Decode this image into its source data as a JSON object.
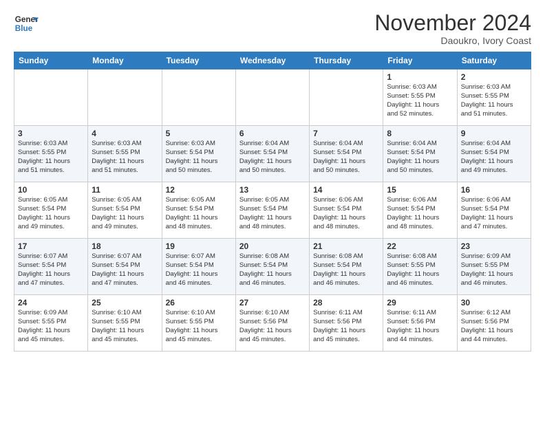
{
  "header": {
    "logo_line1": "General",
    "logo_line2": "Blue",
    "month": "November 2024",
    "location": "Daoukro, Ivory Coast"
  },
  "weekdays": [
    "Sunday",
    "Monday",
    "Tuesday",
    "Wednesday",
    "Thursday",
    "Friday",
    "Saturday"
  ],
  "weeks": [
    [
      {
        "day": "",
        "info": ""
      },
      {
        "day": "",
        "info": ""
      },
      {
        "day": "",
        "info": ""
      },
      {
        "day": "",
        "info": ""
      },
      {
        "day": "",
        "info": ""
      },
      {
        "day": "1",
        "info": "Sunrise: 6:03 AM\nSunset: 5:55 PM\nDaylight: 11 hours\nand 52 minutes."
      },
      {
        "day": "2",
        "info": "Sunrise: 6:03 AM\nSunset: 5:55 PM\nDaylight: 11 hours\nand 51 minutes."
      }
    ],
    [
      {
        "day": "3",
        "info": "Sunrise: 6:03 AM\nSunset: 5:55 PM\nDaylight: 11 hours\nand 51 minutes."
      },
      {
        "day": "4",
        "info": "Sunrise: 6:03 AM\nSunset: 5:55 PM\nDaylight: 11 hours\nand 51 minutes."
      },
      {
        "day": "5",
        "info": "Sunrise: 6:03 AM\nSunset: 5:54 PM\nDaylight: 11 hours\nand 50 minutes."
      },
      {
        "day": "6",
        "info": "Sunrise: 6:04 AM\nSunset: 5:54 PM\nDaylight: 11 hours\nand 50 minutes."
      },
      {
        "day": "7",
        "info": "Sunrise: 6:04 AM\nSunset: 5:54 PM\nDaylight: 11 hours\nand 50 minutes."
      },
      {
        "day": "8",
        "info": "Sunrise: 6:04 AM\nSunset: 5:54 PM\nDaylight: 11 hours\nand 50 minutes."
      },
      {
        "day": "9",
        "info": "Sunrise: 6:04 AM\nSunset: 5:54 PM\nDaylight: 11 hours\nand 49 minutes."
      }
    ],
    [
      {
        "day": "10",
        "info": "Sunrise: 6:05 AM\nSunset: 5:54 PM\nDaylight: 11 hours\nand 49 minutes."
      },
      {
        "day": "11",
        "info": "Sunrise: 6:05 AM\nSunset: 5:54 PM\nDaylight: 11 hours\nand 49 minutes."
      },
      {
        "day": "12",
        "info": "Sunrise: 6:05 AM\nSunset: 5:54 PM\nDaylight: 11 hours\nand 48 minutes."
      },
      {
        "day": "13",
        "info": "Sunrise: 6:05 AM\nSunset: 5:54 PM\nDaylight: 11 hours\nand 48 minutes."
      },
      {
        "day": "14",
        "info": "Sunrise: 6:06 AM\nSunset: 5:54 PM\nDaylight: 11 hours\nand 48 minutes."
      },
      {
        "day": "15",
        "info": "Sunrise: 6:06 AM\nSunset: 5:54 PM\nDaylight: 11 hours\nand 48 minutes."
      },
      {
        "day": "16",
        "info": "Sunrise: 6:06 AM\nSunset: 5:54 PM\nDaylight: 11 hours\nand 47 minutes."
      }
    ],
    [
      {
        "day": "17",
        "info": "Sunrise: 6:07 AM\nSunset: 5:54 PM\nDaylight: 11 hours\nand 47 minutes."
      },
      {
        "day": "18",
        "info": "Sunrise: 6:07 AM\nSunset: 5:54 PM\nDaylight: 11 hours\nand 47 minutes."
      },
      {
        "day": "19",
        "info": "Sunrise: 6:07 AM\nSunset: 5:54 PM\nDaylight: 11 hours\nand 46 minutes."
      },
      {
        "day": "20",
        "info": "Sunrise: 6:08 AM\nSunset: 5:54 PM\nDaylight: 11 hours\nand 46 minutes."
      },
      {
        "day": "21",
        "info": "Sunrise: 6:08 AM\nSunset: 5:54 PM\nDaylight: 11 hours\nand 46 minutes."
      },
      {
        "day": "22",
        "info": "Sunrise: 6:08 AM\nSunset: 5:55 PM\nDaylight: 11 hours\nand 46 minutes."
      },
      {
        "day": "23",
        "info": "Sunrise: 6:09 AM\nSunset: 5:55 PM\nDaylight: 11 hours\nand 46 minutes."
      }
    ],
    [
      {
        "day": "24",
        "info": "Sunrise: 6:09 AM\nSunset: 5:55 PM\nDaylight: 11 hours\nand 45 minutes."
      },
      {
        "day": "25",
        "info": "Sunrise: 6:10 AM\nSunset: 5:55 PM\nDaylight: 11 hours\nand 45 minutes."
      },
      {
        "day": "26",
        "info": "Sunrise: 6:10 AM\nSunset: 5:55 PM\nDaylight: 11 hours\nand 45 minutes."
      },
      {
        "day": "27",
        "info": "Sunrise: 6:10 AM\nSunset: 5:56 PM\nDaylight: 11 hours\nand 45 minutes."
      },
      {
        "day": "28",
        "info": "Sunrise: 6:11 AM\nSunset: 5:56 PM\nDaylight: 11 hours\nand 45 minutes."
      },
      {
        "day": "29",
        "info": "Sunrise: 6:11 AM\nSunset: 5:56 PM\nDaylight: 11 hours\nand 44 minutes."
      },
      {
        "day": "30",
        "info": "Sunrise: 6:12 AM\nSunset: 5:56 PM\nDaylight: 11 hours\nand 44 minutes."
      }
    ]
  ]
}
